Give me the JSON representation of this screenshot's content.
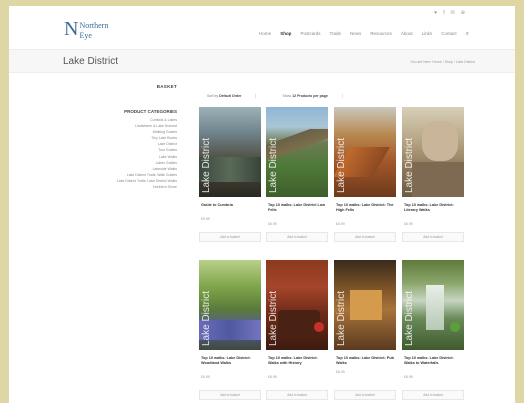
{
  "header": {
    "social": [
      "♥",
      "f",
      "✉",
      "⊕"
    ],
    "logo_mark": "N",
    "logo_line1": "Northern",
    "logo_line2": "Eye",
    "nav": [
      "Home",
      "Shop",
      "Postcards",
      "Trade",
      "News",
      "Resources",
      "About",
      "Links",
      "Contact"
    ],
    "nav_active_index": 1,
    "search_icon": "⌕"
  },
  "titlebar": {
    "title": "Lake District",
    "breadcrumb": "You are here: Home / Shop / Lake District"
  },
  "sidebar": {
    "basket": "BASKET",
    "categories_title": "PRODUCT CATEGORIES",
    "categories": [
      "Cumbria & Lakes",
      "Lindisfarne & Lake Nocrest",
      "Walking Guides",
      "Tiny Lake Books",
      "Lake District",
      "Tour Guides",
      "Lake Walks",
      "Lakes Guides",
      "Lakeside Walks",
      "Lake District Trails: Walk Guides",
      "Lake District Trails: Lake District Walks",
      "Northern Shore"
    ]
  },
  "toolbar": {
    "sort_prefix": "Sort by",
    "sort_value": "Default Order",
    "show_prefix": "Show",
    "show_value": "12 Products per page"
  },
  "products": [
    {
      "name": "Guide to Cumbria",
      "price": "£9.99",
      "button": "Add to basket"
    },
    {
      "name": "Top 10 walks: Lake District Low Fells",
      "price": "£6.99",
      "button": "Add to basket"
    },
    {
      "name": "Top 10 walks: Lake District: The High Fells",
      "price": "£6.99",
      "button": "Add to basket"
    },
    {
      "name": "Top 10 walks: Lake District: Literary Walks",
      "price": "£6.99",
      "button": "Add to basket"
    },
    {
      "name": "Top 10 walks: Lake District: Woodland Walks",
      "price": "£6.99",
      "button": "Add to basket"
    },
    {
      "name": "Top 10 walks: Lake District: Walks with History",
      "price": "£6.99",
      "button": "Add to basket"
    },
    {
      "name": "Top 10 walks: Lake District: Pub Walks",
      "price": "£6.99",
      "button": "Add to basket"
    },
    {
      "name": "Top 10 walks: Lake District: Walks to Waterfalls",
      "price": "£6.99",
      "button": "Add to basket"
    }
  ],
  "cover_text": "Lake District",
  "colors": {
    "page_bg": "#dfd6a5",
    "logo_blue": "#3c6a9a",
    "badge_red": "#c9302c"
  }
}
